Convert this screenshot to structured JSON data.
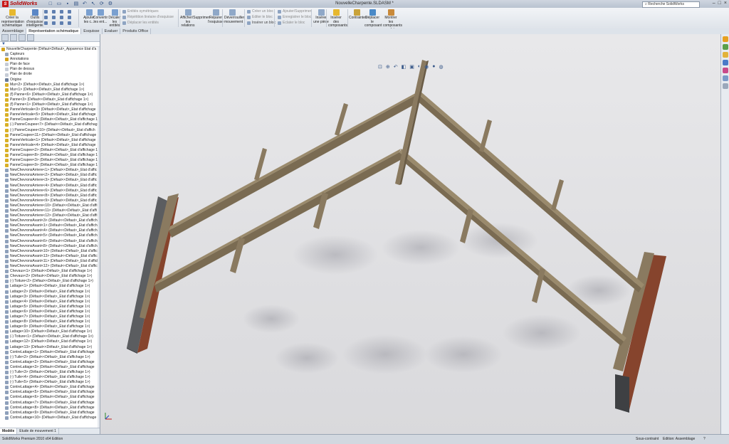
{
  "app": {
    "name": "SolidWorks",
    "document_title": "NouvelleCharpente.SLDASM *",
    "search_placeholder": "Recherche SolidWorks"
  },
  "quick_icons": [
    "new-icon",
    "open-icon",
    "save-icon",
    "print-icon",
    "undo-icon",
    "select-icon",
    "rebuild-icon",
    "options-icon"
  ],
  "ribbon": {
    "big": [
      {
        "label": "Créer la représentation schématique",
        "icon": "create-schematic-icon",
        "color": "#e7b82f"
      },
      {
        "label": "Outils d'esquisse intelligente",
        "icon": "smart-sketch-icon",
        "color": "#5a87c6"
      },
      {
        "label": "Ajouter les c...",
        "icon": "add-icon",
        "color": "#7aa0d0"
      },
      {
        "label": "Convertir les ent...",
        "icon": "convert-icon",
        "color": "#7aa0d0"
      },
      {
        "label": "Décaler les entités",
        "icon": "offset-icon",
        "color": "#7aa0d0"
      },
      {
        "label": "Afficher/Supprimer les relations",
        "icon": "relations-icon",
        "color": "#8fa8c8"
      },
      {
        "label": "Réparer l'esquisse",
        "icon": "repair-icon",
        "color": "#8fa8c8"
      },
      {
        "label": "Déverrouiller mouvement",
        "icon": "unlock-icon",
        "color": "#8fa8c8"
      },
      {
        "label": "Insérer une pièce",
        "icon": "insert-part-icon",
        "color": "#8fa8c8"
      },
      {
        "label": "Insérer des composants",
        "icon": "insert-components-icon",
        "color": "#e7b82f"
      },
      {
        "label": "Contraintes",
        "icon": "mates-icon",
        "color": "#c9a33a"
      },
      {
        "label": "Déplacer le composant",
        "icon": "move-component-icon",
        "color": "#4a8ac8"
      },
      {
        "label": "Montrer les composants cachés",
        "icon": "show-hidden-icon",
        "color": "#c98a3a"
      }
    ],
    "small": [
      {
        "label": "Entités symétriques",
        "enabled": false
      },
      {
        "label": "Répétition linéaire d'esquisse",
        "enabled": false
      },
      {
        "label": "Déplacer les entités",
        "enabled": false
      },
      {
        "label": "Créer un bloc",
        "enabled": false
      },
      {
        "label": "Editer le bloc",
        "enabled": false
      },
      {
        "label": "Insérer un bloc",
        "enabled": true
      },
      {
        "label": "Ajouter/Supprimer",
        "enabled": false
      },
      {
        "label": "Enregistrer le bloc",
        "enabled": false
      },
      {
        "label": "Eclater le bloc",
        "enabled": false
      }
    ]
  },
  "cm_tabs": [
    "Assemblage",
    "Représentation schématique",
    "Esquisse",
    "Evaluer",
    "Produits Office"
  ],
  "fm": {
    "filter_icon": "filter-icon",
    "tree": [
      {
        "t": "NouvelleCharpente (Défaut<Défaut>_Apparence Etat d'a",
        "k": "asm"
      },
      {
        "t": "Capteurs",
        "k": "folder"
      },
      {
        "t": "Annotations",
        "k": "annot"
      },
      {
        "t": "Plan de face",
        "k": "plane"
      },
      {
        "t": "Plan de dessus",
        "k": "plane"
      },
      {
        "t": "Plan de droite",
        "k": "plane"
      },
      {
        "t": "Origine",
        "k": "origin"
      },
      {
        "t": "Mur<2> (Défaut<<Défaut>_Etat d'affichage 1>)",
        "k": "part"
      },
      {
        "t": "Mur<1> (Défaut<<Défaut>_Etat d'affichage 1>)",
        "k": "part"
      },
      {
        "t": "(f) Panne<6> (Défaut<<Défaut>_Etat d'affichage 1>)",
        "k": "part"
      },
      {
        "t": "Panne<3> (Défaut<<Défaut>_Etat d'affichage 1>)",
        "k": "part"
      },
      {
        "t": "(f) Panne<1> (Défaut<<Défaut>_Etat d'affichage 1>)",
        "k": "part"
      },
      {
        "t": "PanneVerticale<3> (Défaut<<Défaut>_Etat d'affichage",
        "k": "part"
      },
      {
        "t": "PanneVerticale<5> (Défaut<<Défaut>_Etat d'affichage",
        "k": "part"
      },
      {
        "t": "PanneCoupee<4> (Défaut<<Défaut>_Etat d'affichage 1",
        "k": "part"
      },
      {
        "t": "(-) PanneCoupee<7> (Défaut<<Défaut>_Etat d'affichag",
        "k": "part"
      },
      {
        "t": "(-) PanneCoupee<10> (Défaut<<Défaut>_Etat d'affich",
        "k": "part"
      },
      {
        "t": "PanneCoupee<11> (Défaut<<Défaut>_Etat d'affichage 1",
        "k": "part"
      },
      {
        "t": "PanneVerticale<1> (Défaut<<Défaut>_Etat d'affichage",
        "k": "part"
      },
      {
        "t": "PanneVerticale<4> (Défaut<<Défaut>_Etat d'affichage",
        "k": "part"
      },
      {
        "t": "PanneCoupee<2> (Défaut<<Défaut>_Etat d'affichage 1",
        "k": "part"
      },
      {
        "t": "PanneCoupee<8> (Défaut<<Défaut>_Etat d'affichage 1",
        "k": "part"
      },
      {
        "t": "PanneCoupee<3> (Défaut<<Défaut>_Etat d'affichage 1",
        "k": "part"
      },
      {
        "t": "PanneCoupee<9> (Défaut<<Défaut>_Etat d'affichage 1",
        "k": "part"
      },
      {
        "t": "NewChevronsArriere<1> (Défaut<<Défaut>_Etat d'affic",
        "k": "pattern"
      },
      {
        "t": "NewChevronsArriere<2> (Défaut<<Défaut>_Etat d'affic",
        "k": "pattern"
      },
      {
        "t": "NewChevronsArriere<3> (Défaut<<Défaut>_Etat d'affic",
        "k": "pattern"
      },
      {
        "t": "NewChevronsArriere<4> (Défaut<<Défaut>_Etat d'affic",
        "k": "pattern"
      },
      {
        "t": "NewChevronsArriere<6> (Défaut<<Défaut>_Etat d'affic",
        "k": "pattern"
      },
      {
        "t": "NewChevronsArriere<8> (Défaut<<Défaut>_Etat d'affic",
        "k": "pattern"
      },
      {
        "t": "NewChevronsArriere<9> (Défaut<<Défaut>_Etat d'affic",
        "k": "pattern"
      },
      {
        "t": "NewChevronsArriere<10> (Défaut<<Défaut>_Etat d'affi",
        "k": "pattern"
      },
      {
        "t": "NewChevronsArriere<11> (Défaut<<Défaut>_Etat d'affi",
        "k": "pattern"
      },
      {
        "t": "NewChevronsArriere<12> (Défaut<<Défaut>_Etat d'affi",
        "k": "pattern"
      },
      {
        "t": "NewChevronsAvant<3> (Défaut<<Défaut>_Etat d'afficha",
        "k": "pattern"
      },
      {
        "t": "NewChevronsAvant<1> (Défaut<<Défaut>_Etat d'afficha",
        "k": "pattern"
      },
      {
        "t": "NewChevronsAvant<4> (Défaut<<Défaut>_Etat d'afficha",
        "k": "pattern"
      },
      {
        "t": "NewChevronsAvant<5> (Défaut<<Défaut>_Etat d'afficha",
        "k": "pattern"
      },
      {
        "t": "NewChevronsAvant<6> (Défaut<<Défaut>_Etat d'afficha",
        "k": "pattern"
      },
      {
        "t": "NewChevronsAvant<8> (Défaut<<Défaut>_Etat d'afficha",
        "k": "pattern"
      },
      {
        "t": "NewChevronsAvant<10> (Défaut<<Défaut>_Etat d'affich",
        "k": "pattern"
      },
      {
        "t": "NewChevronsAvant<13> (Défaut<<Défaut>_Etat d'affich",
        "k": "pattern"
      },
      {
        "t": "NewChevronsAvant<11> (Défaut<<Défaut>_Etat d'affich",
        "k": "pattern"
      },
      {
        "t": "NewChevronsAvant<12> (Défaut<<Défaut>_Etat d'affich",
        "k": "pattern"
      },
      {
        "t": "Chevaux<1> (Défaut<<Défaut>_Etat d'affichage 1>)",
        "k": "pattern"
      },
      {
        "t": "Chevaux<2> (Défaut<<Défaut>_Etat d'affichage 1>)",
        "k": "pattern"
      },
      {
        "t": "(-) Toiture<2> (Défaut<<Défaut>_Etat d'affichage 1>)",
        "k": "pattern"
      },
      {
        "t": "Lattage<1> (Défaut<<Défaut>_Etat d'affichage 1>)",
        "k": "pattern"
      },
      {
        "t": "Lattage<2> (Défaut<<Défaut>_Etat d'affichage 1>)",
        "k": "pattern"
      },
      {
        "t": "Lattage<3> (Défaut<<Défaut>_Etat d'affichage 1>)",
        "k": "pattern"
      },
      {
        "t": "Lattage<4> (Défaut<<Défaut>_Etat d'affichage 1>)",
        "k": "pattern"
      },
      {
        "t": "Lattage<5> (Défaut<<Défaut>_Etat d'affichage 1>)",
        "k": "pattern"
      },
      {
        "t": "Lattage<6> (Défaut<<Défaut>_Etat d'affichage 1>)",
        "k": "pattern"
      },
      {
        "t": "Lattage<7> (Défaut<<Défaut>_Etat d'affichage 1>)",
        "k": "pattern"
      },
      {
        "t": "Lattage<8> (Défaut<<Défaut>_Etat d'affichage 1>)",
        "k": "pattern"
      },
      {
        "t": "Lattage<9> (Défaut<<Défaut>_Etat d'affichage 1>)",
        "k": "pattern"
      },
      {
        "t": "Lattage<10> (Défaut<<Défaut>_Etat d'affichage 1>)",
        "k": "pattern"
      },
      {
        "t": "(-) Toiture<1> (Défaut<<Défaut>_Etat d'affichage 1>)",
        "k": "pattern"
      },
      {
        "t": "Lattage<12> (Défaut<<Défaut>_Etat d'affichage 1>)",
        "k": "pattern"
      },
      {
        "t": "Lattage<13> (Défaut<<Défaut>_Etat d'affichage 1>)",
        "k": "pattern"
      },
      {
        "t": "ContreLattage<1> (Défaut<<Défaut>_Etat d'affichage",
        "k": "pattern"
      },
      {
        "t": "(-) Tuile<2> (Défaut<<Défaut>_Etat d'affichage 1>)",
        "k": "pattern"
      },
      {
        "t": "ContreLattage<2> (Défaut<<Défaut>_Etat d'affichage",
        "k": "pattern"
      },
      {
        "t": "ContreLattage<3> (Défaut<<Défaut>_Etat d'affichage",
        "k": "pattern"
      },
      {
        "t": "(-) Tuile<3> (Défaut<<Défaut>_Etat d'affichage 1>)",
        "k": "pattern"
      },
      {
        "t": "(-) Tuile<4> (Défaut<<Défaut>_Etat d'affichage 1>)",
        "k": "pattern"
      },
      {
        "t": "(-) Tuile<5> (Défaut<<Défaut>_Etat d'affichage 1>)",
        "k": "pattern"
      },
      {
        "t": "ContreLattage<4> (Défaut<<Défaut>_Etat d'affichage",
        "k": "pattern"
      },
      {
        "t": "ContreLattage<5> (Défaut<<Défaut>_Etat d'affichage",
        "k": "pattern"
      },
      {
        "t": "ContreLattage<6> (Défaut<<Défaut>_Etat d'affichage",
        "k": "pattern"
      },
      {
        "t": "ContreLattage<7> (Défaut<<Défaut>_Etat d'affichage",
        "k": "pattern"
      },
      {
        "t": "ContreLattage<8> (Défaut<<Défaut>_Etat d'affichage",
        "k": "pattern"
      },
      {
        "t": "ContreLattage<9> (Défaut<<Défaut>_Etat d'affichage",
        "k": "pattern"
      },
      {
        "t": "ContreLattage<10> (Défaut<<Défaut>_Etat d'affichage",
        "k": "pattern"
      }
    ],
    "bottom_tabs": [
      "Modèle",
      "Etude de mouvement 1"
    ]
  },
  "status": {
    "left": "SolidWorks Premium 2010 x64 Edition",
    "defined": "Sous-contraint",
    "mode": "Edition: Assemblage",
    "help": "?"
  },
  "tree_icon_colors": {
    "asm": "#d4a21c",
    "folder": "#9aa7b8",
    "annot": "#d4a21c",
    "plane": "#c6ccd6",
    "origin": "#6a7c99",
    "part": "#d9b026",
    "pattern": "#8ea0bb"
  }
}
